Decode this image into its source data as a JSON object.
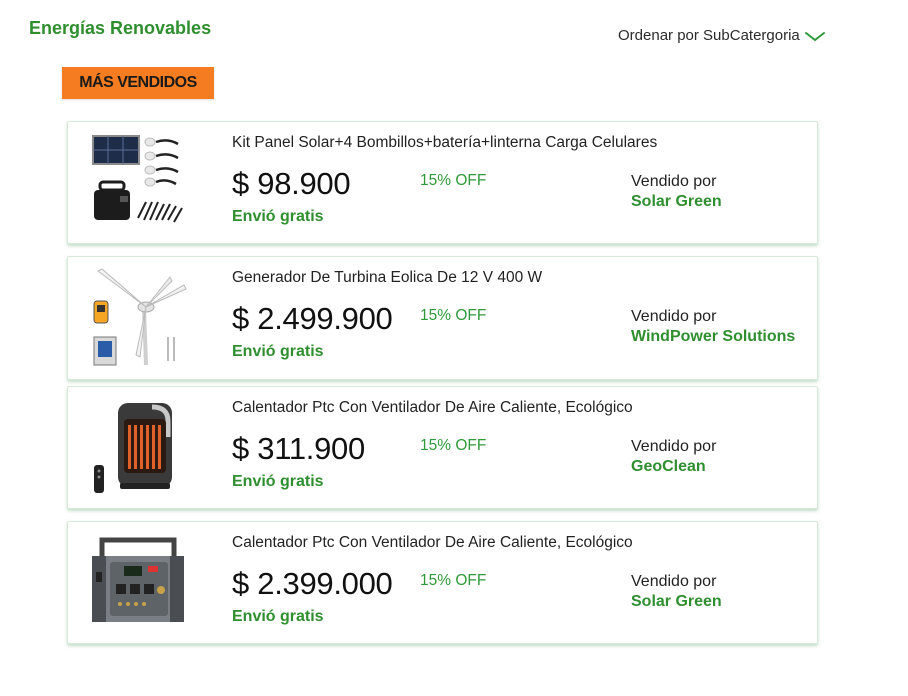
{
  "header": {
    "title": "Energías Renovables",
    "sort_label": "Ordenar por SubCatergoria",
    "sort_icon": "chevron-down-icon"
  },
  "badge": {
    "label": "MÁS VENDIDOS",
    "color": "#f57c20"
  },
  "colors": {
    "accent": "#2f8f2f",
    "discount": "#2f9a3a"
  },
  "products": [
    {
      "title": "Kit Panel Solar+4 Bombillos+batería+linterna Carga Celulares",
      "price": "$ 98.900",
      "discount": "15% OFF",
      "shipping": "Envió gratis",
      "sold_by_label": "Vendido por",
      "seller": "Solar Green",
      "image": "solar-kit-image"
    },
    {
      "title": "Generador De Turbina Eolica De 12 V 400 W",
      "price": "$ 2.499.900",
      "discount": "15% OFF",
      "shipping": "Envió gratis",
      "sold_by_label": "Vendido por",
      "seller": "WindPower Solutions",
      "image": "wind-turbine-image"
    },
    {
      "title": "Calentador Ptc Con Ventilador De Aire Caliente, Ecológico",
      "price": "$ 311.900",
      "discount": "15% OFF",
      "shipping": "Envió gratis",
      "sold_by_label": "Vendido por",
      "seller": "GeoClean",
      "image": "heater-image"
    },
    {
      "title": "Calentador Ptc Con Ventilador De Aire Caliente, Ecológico",
      "price": "$ 2.399.000",
      "discount": "15% OFF",
      "shipping": "Envió gratis",
      "sold_by_label": "Vendido por",
      "seller": "Solar Green",
      "image": "power-station-image"
    }
  ]
}
